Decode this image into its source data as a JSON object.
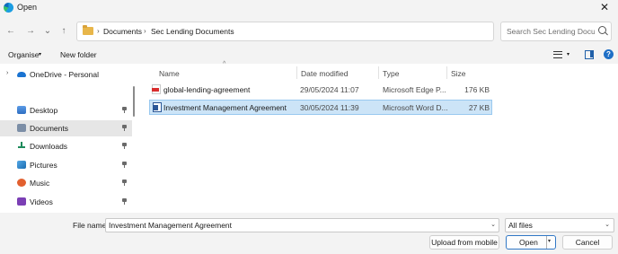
{
  "window": {
    "title": "Open",
    "close_glyph": "✕",
    "app_icon": "edge-icon"
  },
  "nav": {
    "back": "←",
    "forward": "→",
    "recent": "⌄",
    "up": "↑"
  },
  "address": {
    "crumb_sep": "›",
    "crumbs": [
      "Documents",
      "Sec Lending Documents"
    ],
    "dropdown_glyph": "⌄",
    "refresh_glyph": "⟳"
  },
  "search": {
    "placeholder": "Search Sec Lending Documents"
  },
  "toolbar": {
    "organise": "Organise",
    "organise_chevron": "▾",
    "new_folder": "New folder",
    "view_chevron": "▾",
    "help": "?"
  },
  "sidebar": {
    "items": [
      {
        "label": "OneDrive - Personal",
        "icon": "onedrive-icon",
        "chevron": "›",
        "pinned": false
      },
      {
        "label": "Desktop",
        "icon": "desktop-icon",
        "pinned": true
      },
      {
        "label": "Documents",
        "icon": "documents-icon",
        "pinned": true,
        "selected": true
      },
      {
        "label": "Downloads",
        "icon": "downloads-icon",
        "pinned": true
      },
      {
        "label": "Pictures",
        "icon": "pictures-icon",
        "pinned": true
      },
      {
        "label": "Music",
        "icon": "music-icon",
        "pinned": true
      },
      {
        "label": "Videos",
        "icon": "videos-icon",
        "pinned": true
      }
    ]
  },
  "files": {
    "sort_glyph": "^",
    "columns": [
      "Name",
      "Date modified",
      "Type",
      "Size"
    ],
    "rows": [
      {
        "name": "global-lending-agreement",
        "date": "29/05/2024 11:07",
        "type": "Microsoft Edge P...",
        "size": "176 KB",
        "icon": "pdf-icon"
      },
      {
        "name": "Investment Management Agreement",
        "date": "30/05/2024 11:39",
        "type": "Microsoft Word D...",
        "size": "27 KB",
        "icon": "word-icon",
        "selected": true
      }
    ]
  },
  "footer": {
    "file_name_label": "File name:",
    "file_name_value": "Investment Management Agreement",
    "dropdown_glyph": "⌄",
    "file_type": "All files",
    "upload_button": "Upload from mobile",
    "open_button": "Open",
    "open_split_glyph": "▾",
    "cancel_button": "Cancel"
  },
  "colors": {
    "accent": "#3178c6",
    "selection": "#cce4f7",
    "selection_border": "#99c9ef"
  }
}
